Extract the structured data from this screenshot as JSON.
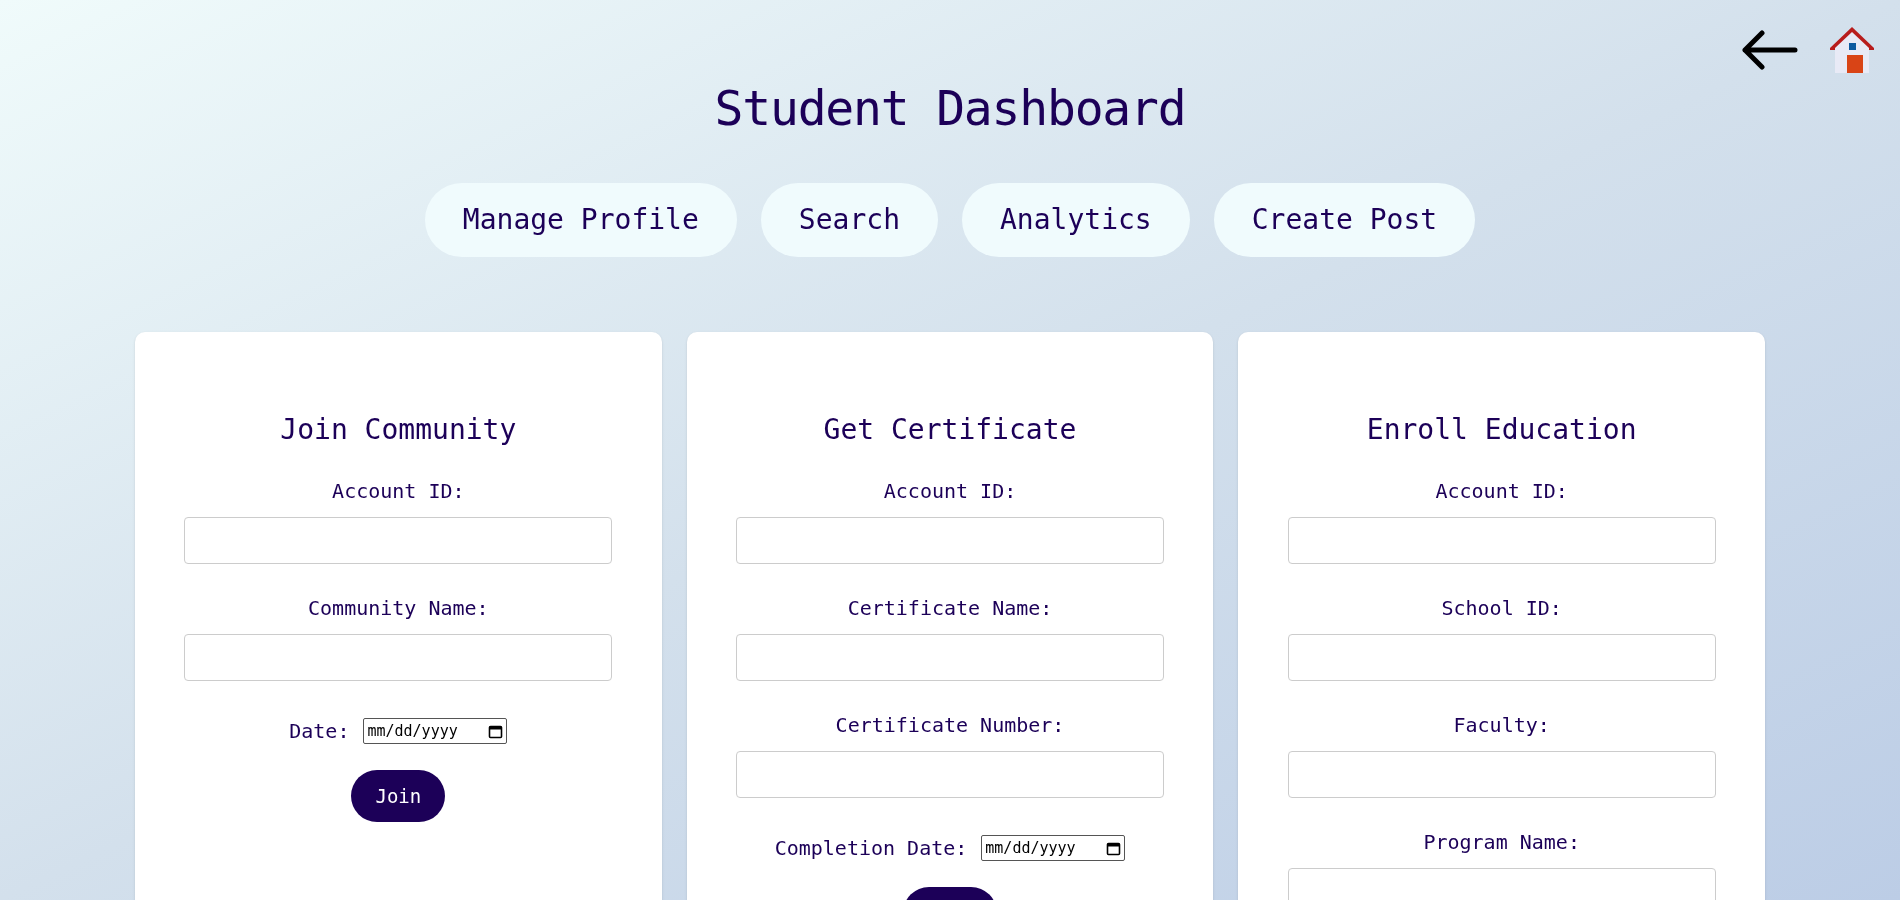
{
  "title": "Student Dashboard",
  "nav": [
    "Manage Profile",
    "Search",
    "Analytics",
    "Create Post"
  ],
  "forms": [
    {
      "title": "Join Community",
      "fields": [
        {
          "kind": "text",
          "label": "Account ID:"
        },
        {
          "kind": "text",
          "label": "Community Name:"
        },
        {
          "kind": "date",
          "label": "Date:",
          "placeholder": "mm/dd/yyyy"
        }
      ],
      "has_button": true,
      "button": {
        "label": "Join"
      }
    },
    {
      "title": "Get Certificate",
      "fields": [
        {
          "kind": "text",
          "label": "Account ID:"
        },
        {
          "kind": "text",
          "label": "Certificate Name:"
        },
        {
          "kind": "text",
          "label": "Certificate Number:"
        },
        {
          "kind": "date",
          "label": "Completion Date:",
          "placeholder": "mm/dd/yyyy"
        }
      ],
      "has_button": true
    },
    {
      "title": "Enroll Education",
      "fields": [
        {
          "kind": "text",
          "label": "Account ID:"
        },
        {
          "kind": "text",
          "label": "School ID:"
        },
        {
          "kind": "text",
          "label": "Faculty:"
        },
        {
          "kind": "text",
          "label": "Program Name:"
        }
      ]
    }
  ]
}
